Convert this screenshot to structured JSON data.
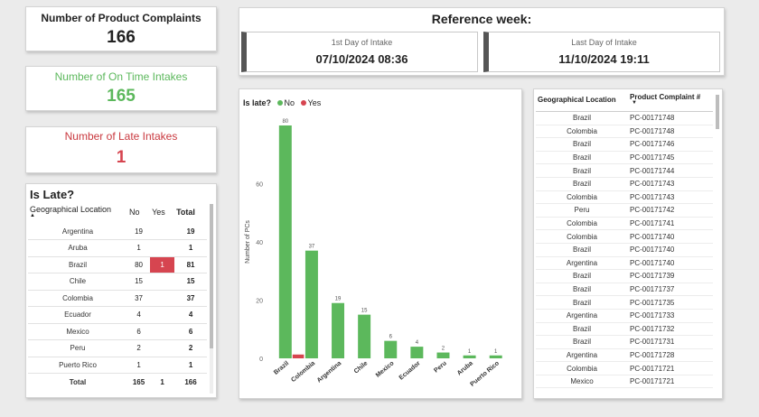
{
  "kpis": {
    "complaints": {
      "title": "Number of Product Complaints",
      "value": "166"
    },
    "on_time": {
      "title": "Number of On Time Intakes",
      "value": "165"
    },
    "late": {
      "title": "Number of Late Intakes",
      "value": "1"
    }
  },
  "reference": {
    "title": "Reference week:",
    "first": {
      "label": "1st Day of Intake",
      "value": "07/10/2024 08:36"
    },
    "last": {
      "label": "Last Day of Intake",
      "value": "11/10/2024 19:11"
    }
  },
  "matrix": {
    "title": "Is Late?",
    "headers": {
      "location": "Geographical Location",
      "no": "No",
      "yes": "Yes",
      "total": "Total"
    },
    "rows": [
      {
        "loc": "Argentina",
        "no": "19",
        "yes": "",
        "total": "19"
      },
      {
        "loc": "Aruba",
        "no": "1",
        "yes": "",
        "total": "1"
      },
      {
        "loc": "Brazil",
        "no": "80",
        "yes": "1",
        "total": "81"
      },
      {
        "loc": "Chile",
        "no": "15",
        "yes": "",
        "total": "15"
      },
      {
        "loc": "Colombia",
        "no": "37",
        "yes": "",
        "total": "37"
      },
      {
        "loc": "Ecuador",
        "no": "4",
        "yes": "",
        "total": "4"
      },
      {
        "loc": "Mexico",
        "no": "6",
        "yes": "",
        "total": "6"
      },
      {
        "loc": "Peru",
        "no": "2",
        "yes": "",
        "total": "2"
      },
      {
        "loc": "Puerto Rico",
        "no": "1",
        "yes": "",
        "total": "1"
      }
    ],
    "total_row": {
      "loc": "Total",
      "no": "165",
      "yes": "1",
      "total": "166"
    }
  },
  "chart_data": {
    "type": "bar",
    "legend_title": "Is late?",
    "legend_position": "top-left",
    "grid": false,
    "ylabel": "Number of PCs",
    "ylim": [
      0,
      80
    ],
    "yticks": [
      "0",
      "20",
      "40",
      "60"
    ],
    "categories": [
      "Brazil",
      "Colombia",
      "Argentina",
      "Chile",
      "Mexico",
      "Ecuador",
      "Peru",
      "Aruba",
      "Puerto Rico"
    ],
    "series": [
      {
        "name": "No",
        "color": "#5cb85c",
        "values": [
          80,
          37,
          19,
          15,
          6,
          4,
          2,
          1,
          1
        ]
      },
      {
        "name": "Yes",
        "color": "#d64550",
        "values": [
          1,
          null,
          null,
          null,
          null,
          null,
          null,
          null,
          null
        ]
      }
    ]
  },
  "complaints_table": {
    "headers": {
      "location": "Geographical Location",
      "id": "Product Complaint #"
    },
    "rows": [
      {
        "loc": "Brazil",
        "id": "PC-00171748"
      },
      {
        "loc": "Colombia",
        "id": "PC-00171748"
      },
      {
        "loc": "Brazil",
        "id": "PC-00171746"
      },
      {
        "loc": "Brazil",
        "id": "PC-00171745"
      },
      {
        "loc": "Brazil",
        "id": "PC-00171744"
      },
      {
        "loc": "Brazil",
        "id": "PC-00171743"
      },
      {
        "loc": "Colombia",
        "id": "PC-00171743"
      },
      {
        "loc": "Peru",
        "id": "PC-00171742"
      },
      {
        "loc": "Colombia",
        "id": "PC-00171741"
      },
      {
        "loc": "Colombia",
        "id": "PC-00171740"
      },
      {
        "loc": "Brazil",
        "id": "PC-00171740"
      },
      {
        "loc": "Argentina",
        "id": "PC-00171740"
      },
      {
        "loc": "Brazil",
        "id": "PC-00171739"
      },
      {
        "loc": "Brazil",
        "id": "PC-00171737"
      },
      {
        "loc": "Brazil",
        "id": "PC-00171735"
      },
      {
        "loc": "Argentina",
        "id": "PC-00171733"
      },
      {
        "loc": "Brazil",
        "id": "PC-00171732"
      },
      {
        "loc": "Brazil",
        "id": "PC-00171731"
      },
      {
        "loc": "Argentina",
        "id": "PC-00171728"
      },
      {
        "loc": "Colombia",
        "id": "PC-00171721"
      },
      {
        "loc": "Mexico",
        "id": "PC-00171721"
      }
    ]
  }
}
